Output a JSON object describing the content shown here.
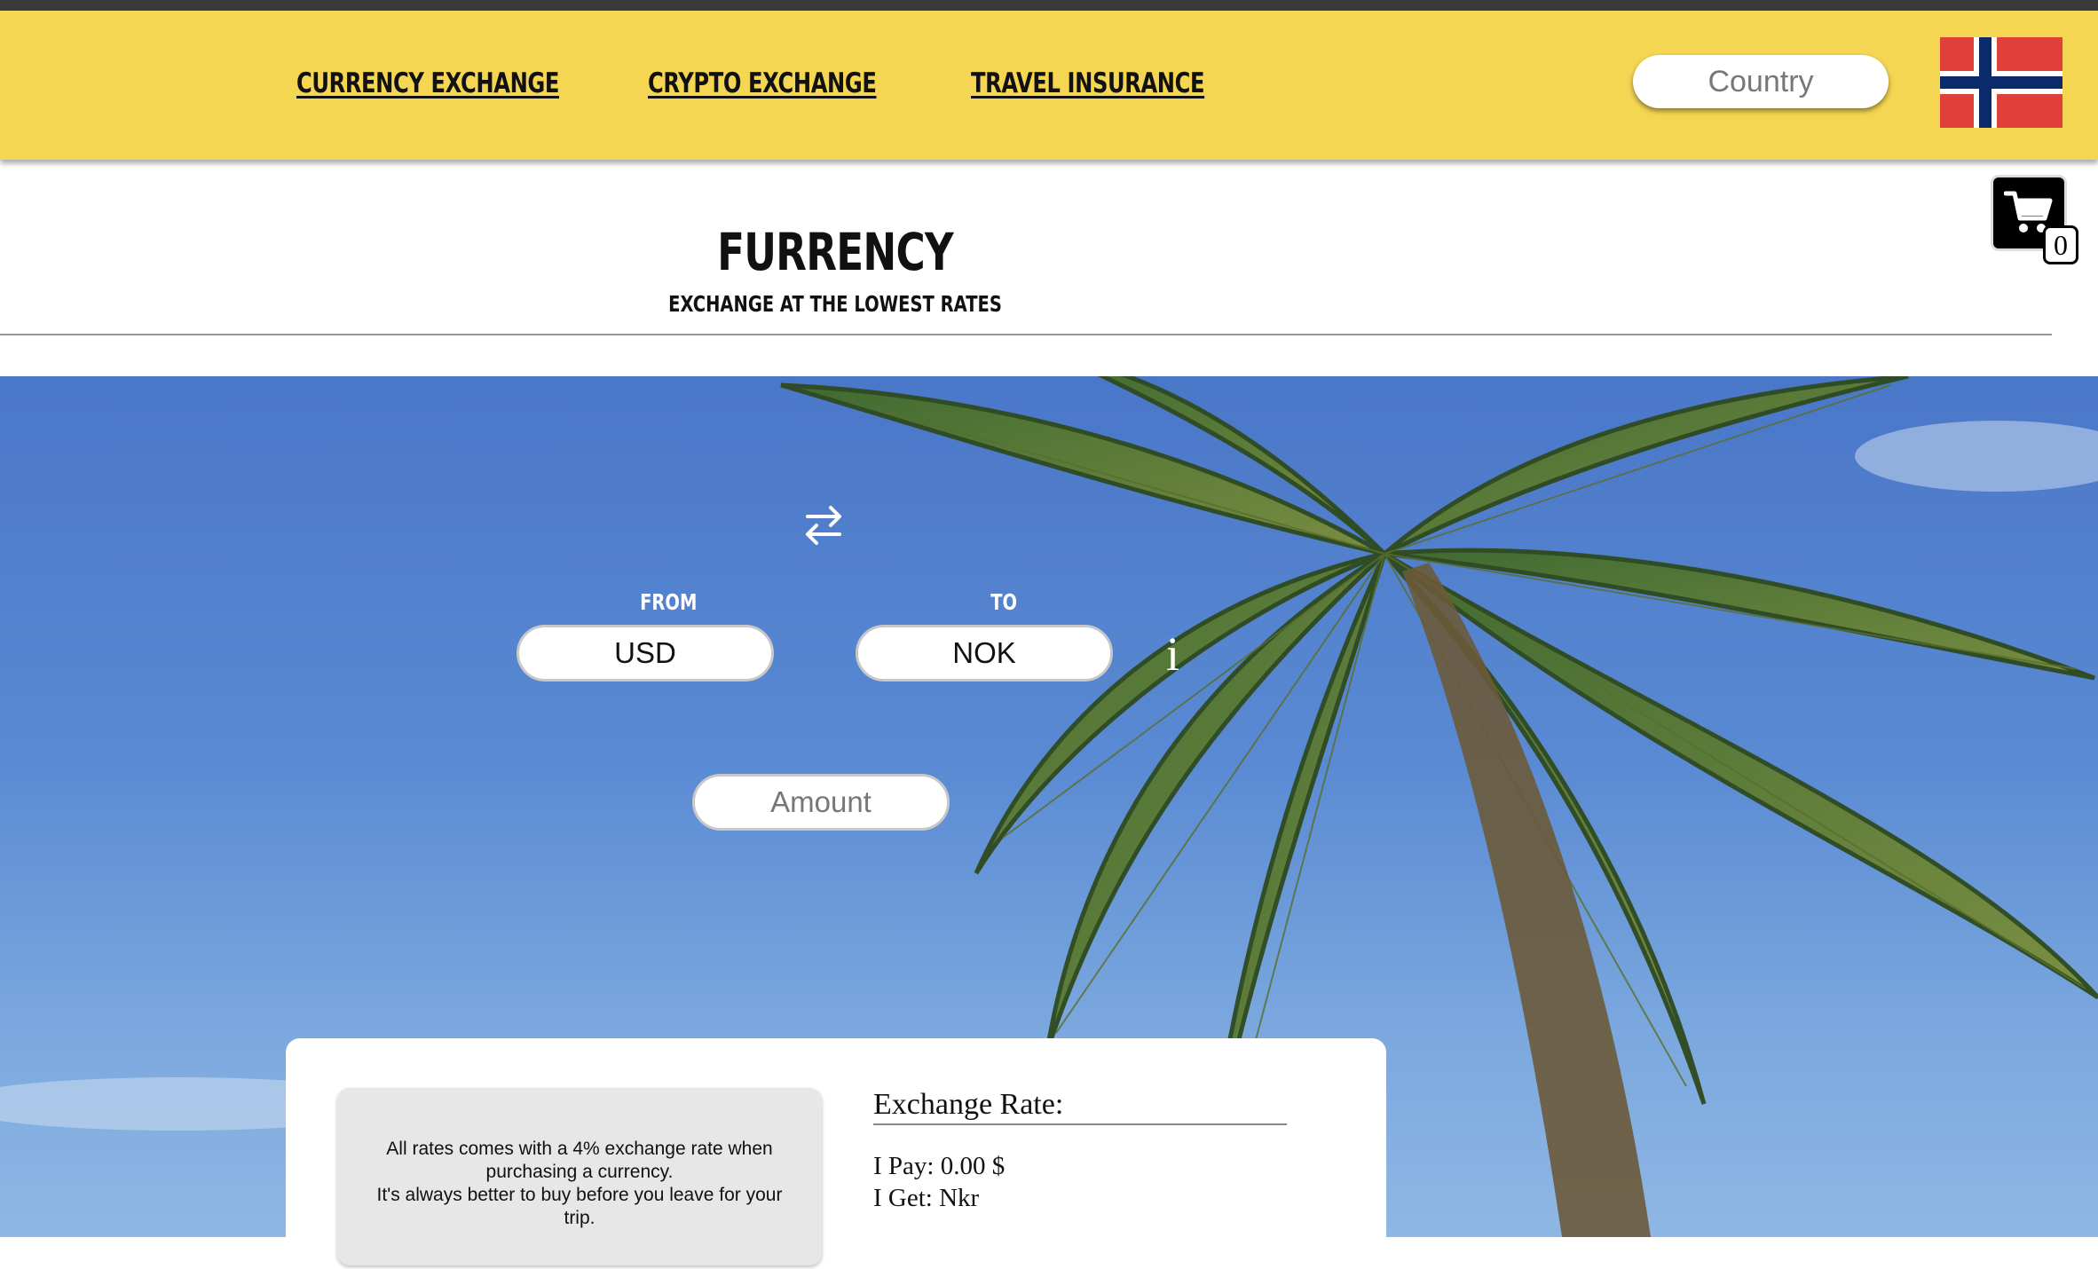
{
  "nav": {
    "links": [
      "CURRENCY EXCHANGE",
      "CRYPTO EXCHANGE",
      "TRAVEL INSURANCE"
    ],
    "country_placeholder": "Country"
  },
  "cart": {
    "count": "0"
  },
  "brand": {
    "title": "FURRENCY",
    "subtitle": "EXCHANGE AT THE LOWEST RATES"
  },
  "converter": {
    "from_label": "FROM",
    "to_label": "TO",
    "from_currency": "USD",
    "to_currency": "NOK",
    "amount_placeholder": "Amount",
    "info": "i"
  },
  "notice": {
    "line1": "All rates comes with a 4% exchange rate when purchasing a currency.",
    "line2": "It's always better to buy before you leave for your trip."
  },
  "rates": {
    "title": "Exchange Rate:",
    "pay": "I Pay: 0.00 $",
    "get": "I Get: Nkr"
  },
  "colors": {
    "nav_bg": "#f4d653",
    "flag_red": "#e0403a",
    "flag_blue": "#0b2a6b"
  }
}
